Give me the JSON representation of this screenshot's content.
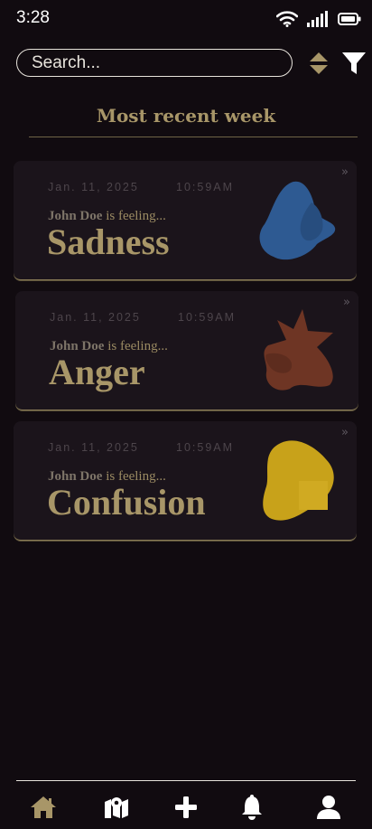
{
  "status": {
    "time": "3:28"
  },
  "search": {
    "placeholder": "Search..."
  },
  "section": {
    "title": "Most recent week"
  },
  "entries": [
    {
      "date": "Jan. 11, 2025",
      "time": "10:59AM",
      "user": "John Doe",
      "suffix": " is feeling...",
      "emotion": "Sadness",
      "color": "#2e5a92"
    },
    {
      "date": "Jan. 11, 2025",
      "time": "10:59AM",
      "user": "John Doe",
      "suffix": " is feeling...",
      "emotion": "Anger",
      "color": "#6e3524"
    },
    {
      "date": "Jan. 11, 2025",
      "time": "10:59AM",
      "user": "John Doe",
      "suffix": " is feeling...",
      "emotion": "Confusion",
      "color": "#c8a21a"
    }
  ],
  "nav": {
    "items": [
      {
        "icon": "home-icon",
        "active": true
      },
      {
        "icon": "map-icon",
        "active": false
      },
      {
        "icon": "plus-icon",
        "active": false
      },
      {
        "icon": "bell-icon",
        "active": false
      },
      {
        "icon": "user-icon",
        "active": false
      }
    ]
  },
  "colors": {
    "background": "#110b10",
    "accent": "#a89668",
    "card": "#1b141b"
  }
}
